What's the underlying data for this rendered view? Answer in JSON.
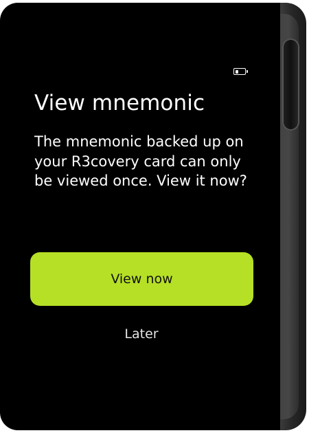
{
  "status": {
    "battery_icon": "battery-icon",
    "battery_level": 0.35
  },
  "dialog": {
    "title": "View mnemonic",
    "message": "The mnemonic backed up on your R3covery card can only be viewed once. View it now?",
    "primary_label": "View now",
    "secondary_label": "Later"
  },
  "colors": {
    "screen_background": "#000000",
    "text": "#ffffff",
    "accent": "#b6e026",
    "device_frame": "#2e2e2e"
  }
}
